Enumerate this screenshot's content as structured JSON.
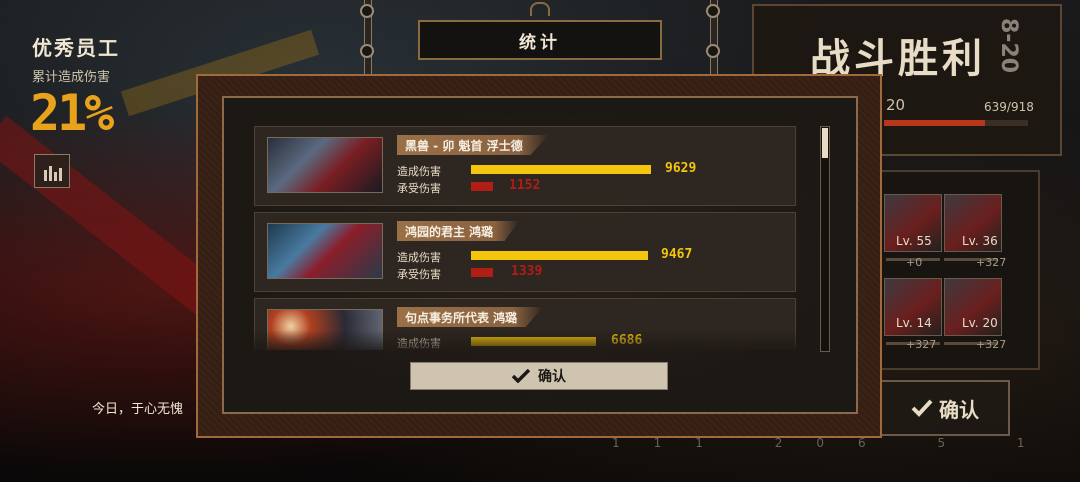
{
  "employee": {
    "title": "优秀员工",
    "subtitle": "累计造成伤害",
    "percent": "21%",
    "stats_icon": "bar-chart-icon"
  },
  "quote": "今日，于心无愧",
  "victory": {
    "title": "战斗胜利",
    "stage": "8-20",
    "level_partial": "20",
    "exp": "639/918",
    "exp_fraction": 0.7
  },
  "party": [
    {
      "level": "Lv. 55",
      "exp_gain": "+0"
    },
    {
      "level": "Lv. 36",
      "exp_gain": "+327"
    },
    {
      "level": "Lv. 14",
      "exp_gain": "+327"
    },
    {
      "level": "Lv. 20",
      "exp_gain": "+327"
    }
  ],
  "right_confirm_label": "确认",
  "bottom_numbers": "111  206  5  1",
  "modal": {
    "title": "统计",
    "dealt_label": "造成伤害",
    "taken_label": "承受伤害",
    "confirm_label": "确认",
    "confirm_icon": "checkmark-icon",
    "colors": {
      "dealt": "#f3c50d",
      "taken": "#b01e16"
    },
    "entries": [
      {
        "name": "黑兽 - 卯 魁首 浮士德",
        "dealt": "9629",
        "taken": "1152",
        "dealt_value": 9629,
        "taken_value": 1152
      },
      {
        "name": "鸿园的君主 鸿璐",
        "dealt": "9467",
        "taken": "1339",
        "dealt_value": 9467,
        "taken_value": 1339
      },
      {
        "name": "句点事务所代表 鸿璐",
        "dealt": "6686",
        "taken": "",
        "dealt_value": 6686,
        "taken_value": null
      }
    ]
  }
}
